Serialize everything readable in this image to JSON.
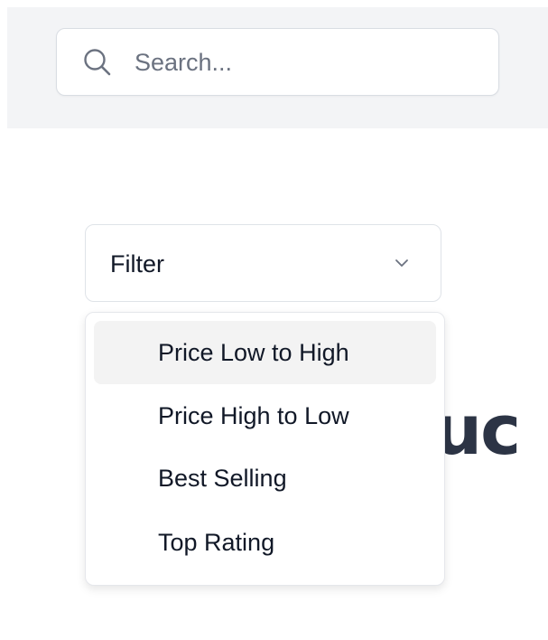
{
  "search": {
    "placeholder": "Search..."
  },
  "filter": {
    "label": "Filter",
    "options": [
      "Price Low to High",
      "Price High to Low",
      "Best Selling",
      "Top Rating"
    ]
  },
  "background": {
    "heading_fragment": "uc"
  },
  "icons": {
    "search": "search-icon",
    "chevron": "chevron-down-icon"
  },
  "colors": {
    "top_band": "#f3f4f6",
    "text": "#111827",
    "placeholder": "#6b7280",
    "heading": "#2c3445",
    "active_item": "#f3f3f3"
  }
}
